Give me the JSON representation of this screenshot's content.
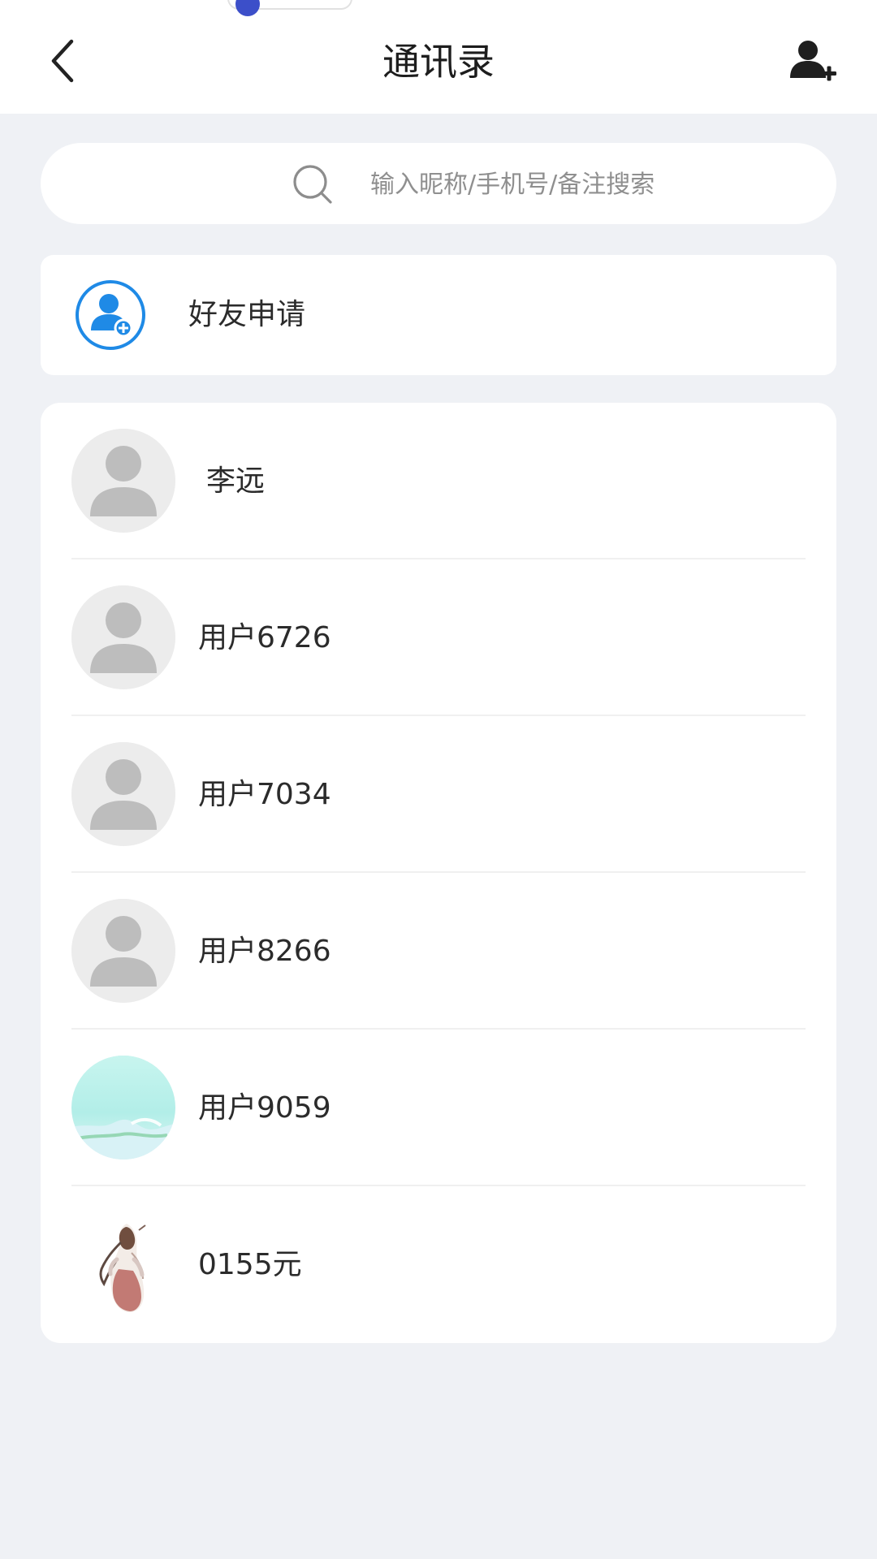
{
  "header": {
    "title": "通讯录",
    "back_icon": "chevron-left-icon",
    "add_icon": "user-plus-icon"
  },
  "search": {
    "placeholder": "输入昵称/手机号/备注搜索",
    "icon": "search-icon"
  },
  "friend_request": {
    "label": "好友申请",
    "icon": "user-plus-circle-icon",
    "accent_color": "#1f8ae6"
  },
  "contacts": [
    {
      "name": "李远",
      "avatar": "default-person-avatar"
    },
    {
      "name": "用户6726",
      "avatar": "default-person-avatar"
    },
    {
      "name": "用户7034",
      "avatar": "default-person-avatar"
    },
    {
      "name": "用户8266",
      "avatar": "default-person-avatar"
    },
    {
      "name": "用户9059",
      "avatar": "landscape-avatar"
    },
    {
      "name": "0155元",
      "avatar": "figure-painting-avatar"
    }
  ],
  "colors": {
    "background": "#eff1f5",
    "surface": "#ffffff",
    "text_primary": "#2b2b2b",
    "placeholder": "#8f8f8f",
    "avatar_gray": "#bcbcbc"
  }
}
